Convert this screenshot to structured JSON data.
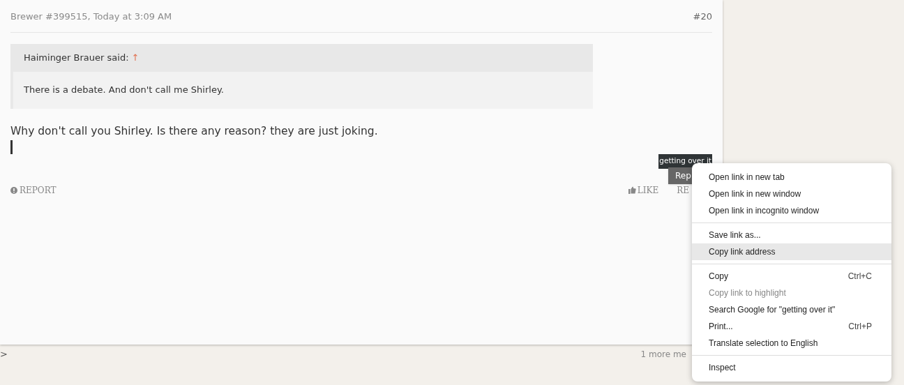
{
  "post": {
    "author_line": "Brewer #399515, Today at 3:09 AM",
    "number": "#20",
    "quote": {
      "author": "Haiminger Brauer said:",
      "jump": "↑",
      "text": "There is a debate. And don't call me Shirley."
    },
    "message": "Why don't call you Shirley. Is there any reason? they are just joking.",
    "selection_tooltip": "getting over it",
    "reply_popup": "Rep",
    "actions": {
      "report": "REPORT",
      "like": "LIKE",
      "reply": "RE"
    }
  },
  "footer": {
    "arrow": ">",
    "more": "1 more me"
  },
  "context_menu": [
    {
      "kind": "item",
      "label": "Open link in new tab",
      "selected": false,
      "disabled": false
    },
    {
      "kind": "item",
      "label": "Open link in new window",
      "selected": false,
      "disabled": false
    },
    {
      "kind": "item",
      "label": "Open link in incognito window",
      "selected": false,
      "disabled": false
    },
    {
      "kind": "separator"
    },
    {
      "kind": "item",
      "label": "Save link as...",
      "selected": false,
      "disabled": false
    },
    {
      "kind": "item",
      "label": "Copy link address",
      "selected": true,
      "disabled": false
    },
    {
      "kind": "separator"
    },
    {
      "kind": "item",
      "label": "Copy",
      "shortcut": "Ctrl+C",
      "selected": false,
      "disabled": false
    },
    {
      "kind": "item",
      "label": "Copy link to highlight",
      "selected": false,
      "disabled": true
    },
    {
      "kind": "item",
      "label": "Search Google for \"getting over it\"",
      "selected": false,
      "disabled": false
    },
    {
      "kind": "item",
      "label": "Print...",
      "shortcut": "Ctrl+P",
      "selected": false,
      "disabled": false
    },
    {
      "kind": "item",
      "label": "Translate selection to English",
      "selected": false,
      "disabled": false
    },
    {
      "kind": "separator"
    },
    {
      "kind": "item",
      "label": "Inspect",
      "selected": false,
      "disabled": false
    }
  ]
}
